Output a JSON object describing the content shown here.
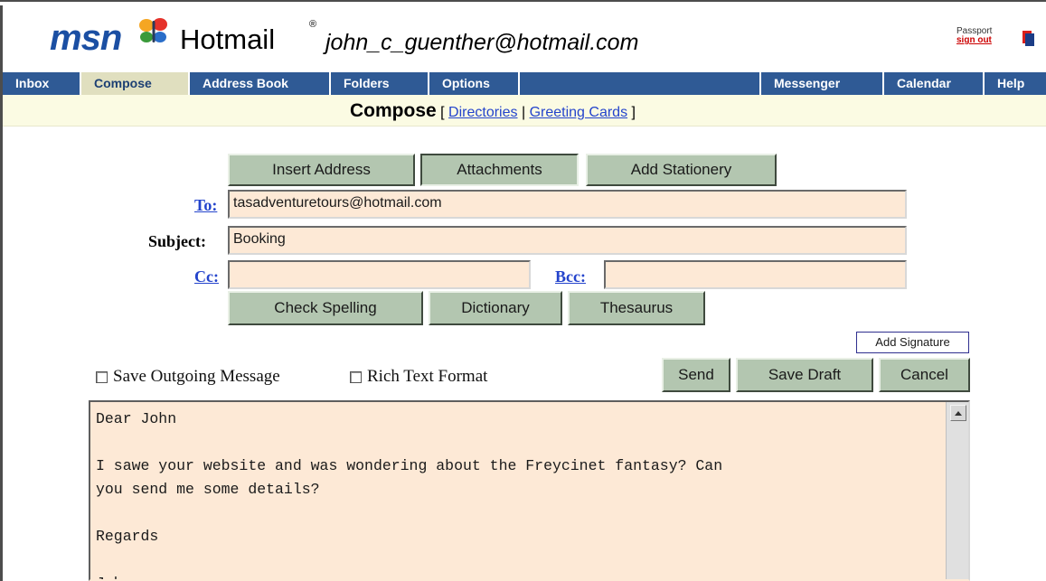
{
  "header": {
    "logo_msn": "msn",
    "logo_hotmail": "Hotmail",
    "registered_mark": "®",
    "user_email": "john_c_guenther@hotmail.com",
    "passport_label": "Passport",
    "signout_label": "sign out"
  },
  "nav": {
    "tabs": [
      {
        "label": "Inbox"
      },
      {
        "label": "Compose"
      },
      {
        "label": "Address Book"
      },
      {
        "label": "Folders"
      },
      {
        "label": "Options"
      }
    ],
    "right_tabs": [
      {
        "label": "Messenger"
      },
      {
        "label": "Calendar"
      },
      {
        "label": "Help"
      }
    ],
    "active": "Compose"
  },
  "subbar": {
    "title": "Compose",
    "open_bracket": "[",
    "directories": "Directories",
    "separator": "|",
    "greeting_cards": "Greeting Cards",
    "close_bracket": "]"
  },
  "toolbar": {
    "insert_address": "Insert Address",
    "attachments": "Attachments",
    "add_stationery": "Add Stationery"
  },
  "fields": {
    "to_label": "To:",
    "to_value": "tasadventuretours@hotmail.com",
    "subject_label": "Subject:",
    "subject_value": "Booking",
    "cc_label": "Cc:",
    "cc_value": "",
    "bcc_label": "Bcc:",
    "bcc_value": ""
  },
  "tools": {
    "check_spelling": "Check Spelling",
    "dictionary": "Dictionary",
    "thesaurus": "Thesaurus",
    "add_signature": "Add Signature"
  },
  "options": {
    "save_outgoing": "Save Outgoing Message",
    "rich_text": "Rich Text Format"
  },
  "actions": {
    "send": "Send",
    "save_draft": "Save Draft",
    "cancel": "Cancel"
  },
  "message": {
    "body": "Dear John\n\nI sawe your website and was wondering about the Freycinet fantasy? Can\nyou send me some details?\n\nRegards\n\nJohn"
  },
  "colors": {
    "nav_bg": "#2f5a95",
    "nav_active_bg": "#e0dfbf",
    "field_bg": "#fde9d6",
    "button_bg": "#b3c6b0",
    "link": "#2444cc"
  }
}
